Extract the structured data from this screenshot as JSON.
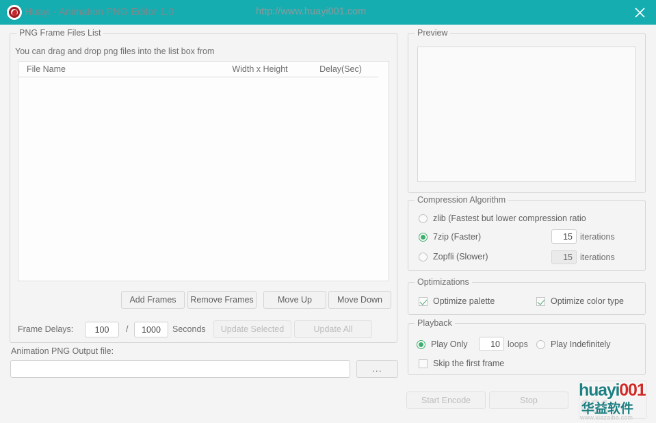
{
  "titlebar": {
    "app_icon": "huayi-logo-icon",
    "title": "Huayi - Animation PNG Editor 1.0",
    "url": "http://www.huayi001.com",
    "close_label": "close-icon",
    "bg_color": "#16adb1",
    "text_color": "#7a8a8c"
  },
  "frames_group": {
    "title": "PNG Frame Files List",
    "drag_hint": "You can drag and drop png files into the list box from",
    "columns": [
      "File Name",
      "Width x Height",
      "Delay(Sec)"
    ],
    "rows": [],
    "buttons": {
      "add": "Add Frames",
      "remove": "Remove Frames",
      "move_up": "Move Up",
      "move_down": "Move Down"
    },
    "delays": {
      "label": "Frame Delays:",
      "numerator": "100",
      "separator": "/",
      "denominator": "1000",
      "unit": "Seconds",
      "update_selected": "Update Selected",
      "update_all": "Update All"
    }
  },
  "output": {
    "label": "Animation PNG Output file:",
    "value": "",
    "placeholder": "",
    "browse_label": "..."
  },
  "preview": {
    "title": "Preview"
  },
  "compression": {
    "title": "Compression Algorithm",
    "options": [
      {
        "label": "zlib (Fastest but lower compression ratio",
        "selected": false
      },
      {
        "label": "7zip (Faster)",
        "selected": true
      },
      {
        "label": "Zopfli (Slower)",
        "selected": false
      }
    ],
    "iterations_7zip": "15",
    "iterations_7zip_label": "iterations",
    "iterations_zopfli": "15",
    "iterations_zopfli_label": "iterations",
    "accent_color": "#3fae6f"
  },
  "optimizations": {
    "title": "Optimizations",
    "items": [
      {
        "label": "Optimize palette",
        "checked": true
      },
      {
        "label": "Optimize color type",
        "checked": true
      }
    ]
  },
  "playback": {
    "title": "Playback",
    "play_only_label": "Play Only",
    "loops_value": "10",
    "loops_label": "loops",
    "play_indefinitely_label": "Play Indefinitely",
    "skip_first_frame_label": "Skip the first frame"
  },
  "actions": {
    "start_encode": "Start Encode",
    "stop": "Stop"
  },
  "watermark": {
    "brand_a": "huayi",
    "brand_b": "001",
    "brand_cn": "华益软件",
    "site": "www.xiazaiba.com",
    "teal": "#1c7f82",
    "red": "#cf2a25"
  }
}
